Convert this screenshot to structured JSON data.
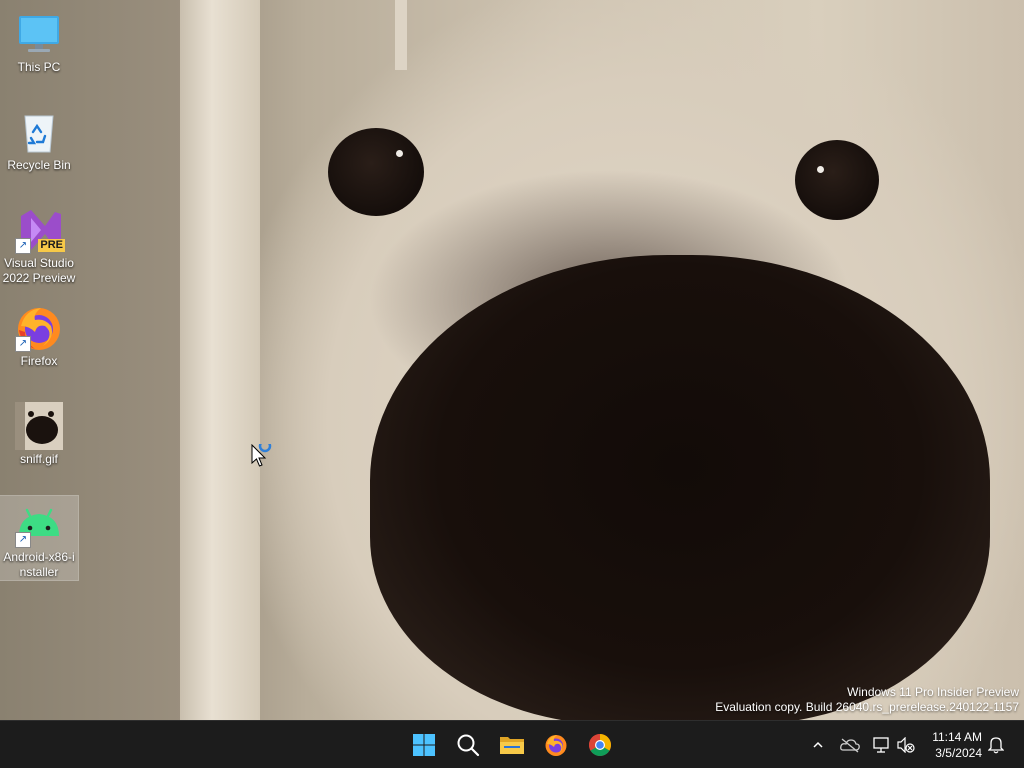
{
  "desktop": {
    "icons": [
      {
        "label": "This PC",
        "icon": "monitor-icon"
      },
      {
        "label": "Recycle Bin",
        "icon": "recycle-bin-icon"
      },
      {
        "label": "Visual Studio 2022 Preview",
        "icon": "visual-studio-icon",
        "badge": "PRE"
      },
      {
        "label": "Firefox",
        "icon": "firefox-icon"
      },
      {
        "label": "sniff.gif",
        "icon": "gif-thumbnail-icon"
      },
      {
        "label": "Android-x86-installer",
        "icon": "android-icon"
      }
    ],
    "watermark": {
      "line1": "Windows 11 Pro Insider Preview",
      "line2": "Evaluation copy. Build 26040.rs_prerelease.240122-1157"
    }
  },
  "taskbar": {
    "apps": [
      "windows-start-icon",
      "search-icon",
      "file-explorer-icon",
      "firefox-icon",
      "chrome-icon"
    ],
    "tray": [
      "chevron-up-icon",
      "onedrive-offline-icon",
      "network-icon",
      "volume-muted-icon",
      "notification-bell-icon"
    ],
    "clock": {
      "time": "11:14 AM",
      "date": "3/5/2024"
    }
  },
  "colors": {
    "taskbar_bg": "#1c1c1c",
    "start_blue": "#4cc2ff",
    "folder_yellow": "#f7c948",
    "android_green": "#3ddc84",
    "vs_purple": "#9b4dca"
  }
}
